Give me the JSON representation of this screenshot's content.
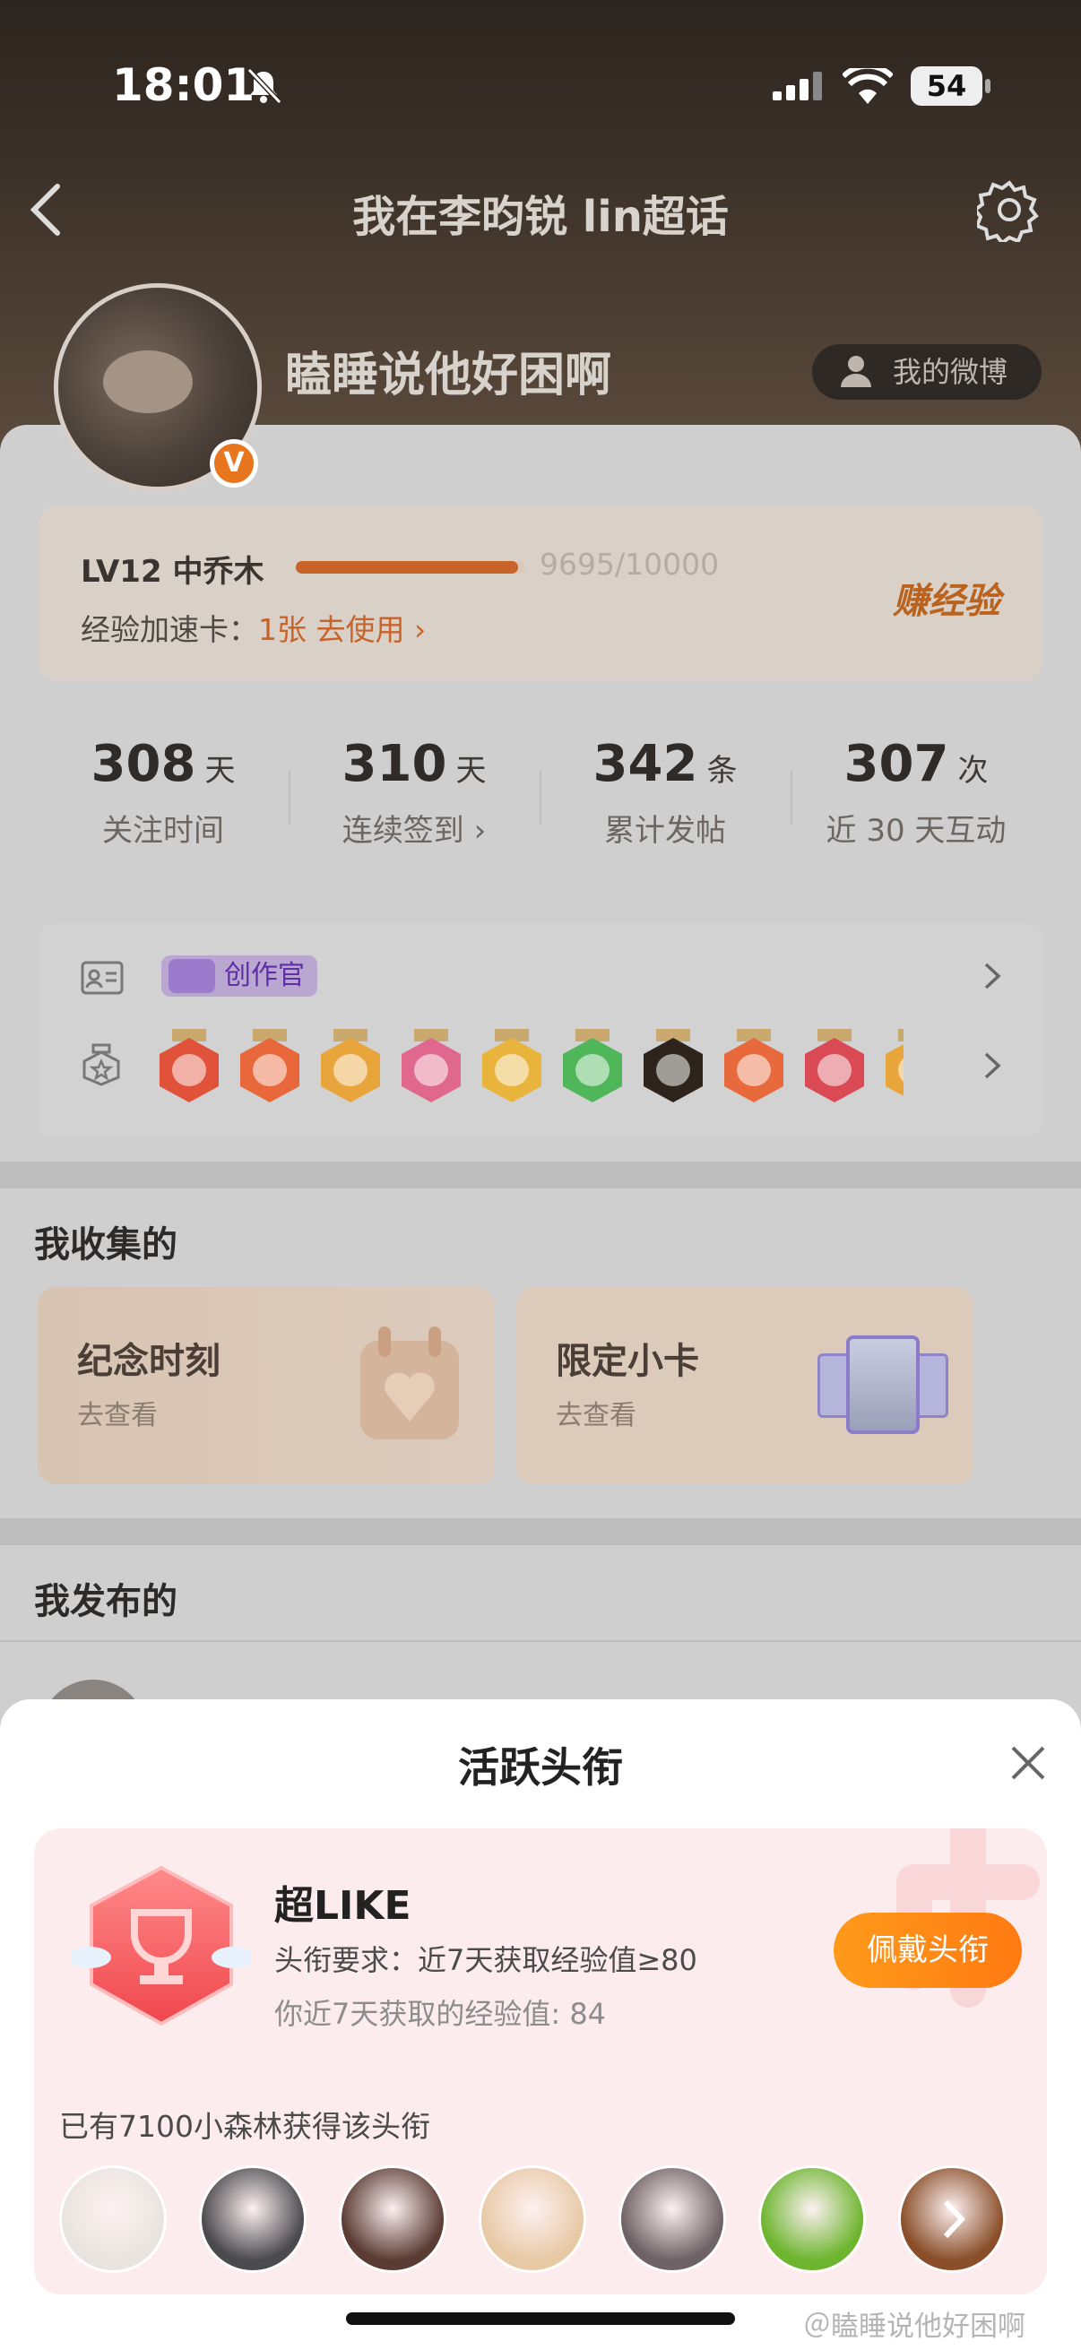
{
  "status_bar": {
    "time": "18:01",
    "battery": "54"
  },
  "nav": {
    "title": "我在李昀锐 lin超话"
  },
  "profile": {
    "username": "瞌睡说他好困啊",
    "verified_badge": "V",
    "my_weibo_label": "我的微博"
  },
  "level": {
    "label": "LV12 中乔木",
    "progress_text": "9695/10000",
    "progress": 0.9695,
    "accel_prefix": "经验加速卡：",
    "accel_value": "1张 去使用 ›",
    "earn_label": "赚经验"
  },
  "stats": [
    {
      "num": "308",
      "unit": "天",
      "label": "关注时间"
    },
    {
      "num": "310",
      "unit": "天",
      "label": "连续签到 ›"
    },
    {
      "num": "342",
      "unit": "条",
      "label": "累计发帖"
    },
    {
      "num": "307",
      "unit": "次",
      "label": "近 30 天互动"
    }
  ],
  "badges": {
    "creator_label": "创作官",
    "medal_colors": [
      "#e0533a",
      "#e8683c",
      "#e8a53c",
      "#e0688f",
      "#e8b43c",
      "#4fb65a",
      "#2e241c",
      "#e86a3c",
      "#d94a55",
      "#e8a53c"
    ]
  },
  "collections": {
    "title": "我收集的",
    "items": [
      {
        "title": "纪念时刻",
        "sub": "去查看"
      },
      {
        "title": "限定小卡",
        "sub": "去查看"
      }
    ]
  },
  "published": {
    "title": "我发布的"
  },
  "sheet": {
    "title": "活跃头衔",
    "title_name": "超LIKE",
    "requirement": "头衔要求：近7天获取经验值≥80",
    "my_value": "你近7天获取的经验值: 84",
    "wear_label": "佩戴头衔",
    "holders_text": "已有7100小森林获得该头衔",
    "avatar_colors": [
      "#e9e4e0",
      "#4b4a4e",
      "#5b3c34",
      "#e8c9a6",
      "#6e6266",
      "#6db52f",
      "#8a4f2a"
    ]
  },
  "watermark": "＠瞌睡说他好困啊"
}
